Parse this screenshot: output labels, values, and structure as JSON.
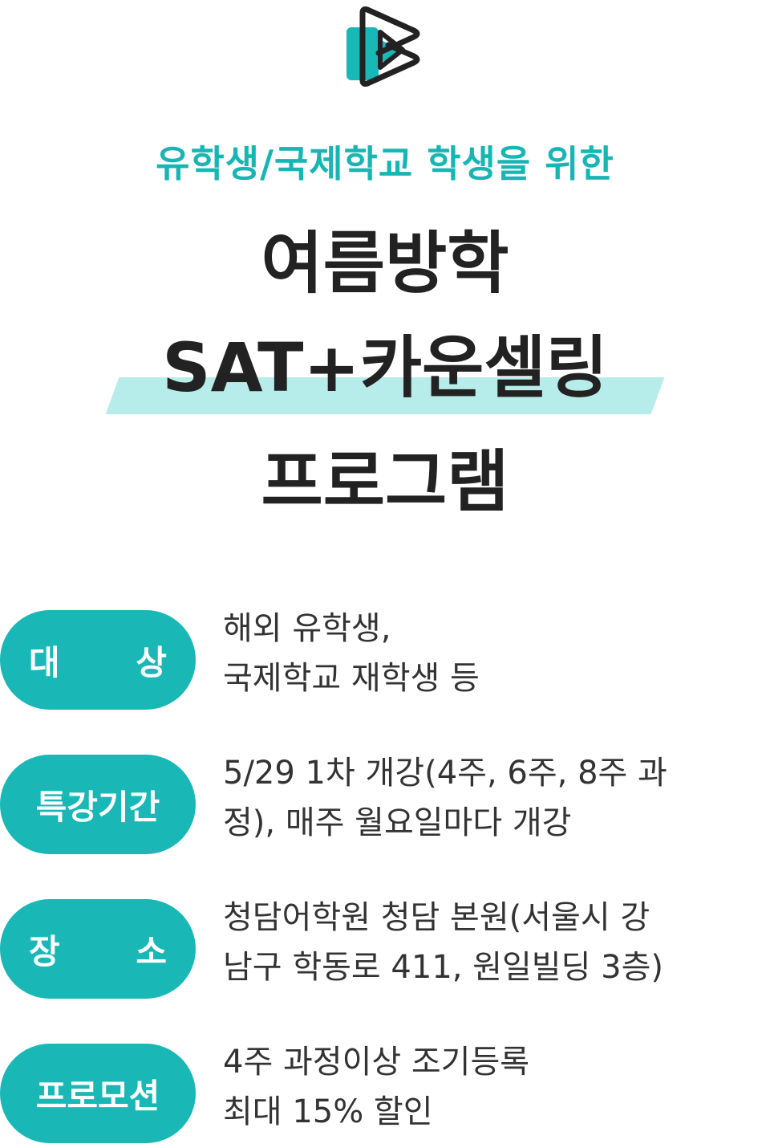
{
  "logo": {
    "icon": "play-logo-icon",
    "colors": {
      "primary": "#19b8b6",
      "outline": "#222222"
    }
  },
  "header": {
    "subtitle": "유학생/국제학교 학생을 위한",
    "title_line1": "여름방학",
    "title_line2": "SAT+카운셀링",
    "title_line3": "프로그램"
  },
  "colors": {
    "accent": "#19b8b6",
    "highlight": "#b6ecea",
    "text": "#222222"
  },
  "info": [
    {
      "label_a": "대",
      "label_b": "상",
      "line1": "해외 유학생,",
      "line2": "국제학교 재학생 등"
    },
    {
      "label": "특강기간",
      "line1": "5/29 1차 개강(4주, 6주, 8주 과",
      "line2": "정), 매주 월요일마다 개강"
    },
    {
      "label_a": "장",
      "label_b": "소",
      "line1": "청담어학원 청담 본원(서울시 강",
      "line2": "남구 학동로 411, 원일빌딩 3층)"
    },
    {
      "label": "프로모션",
      "line1": "4주 과정이상 조기등록",
      "line2": "최대 15% 할인"
    }
  ]
}
